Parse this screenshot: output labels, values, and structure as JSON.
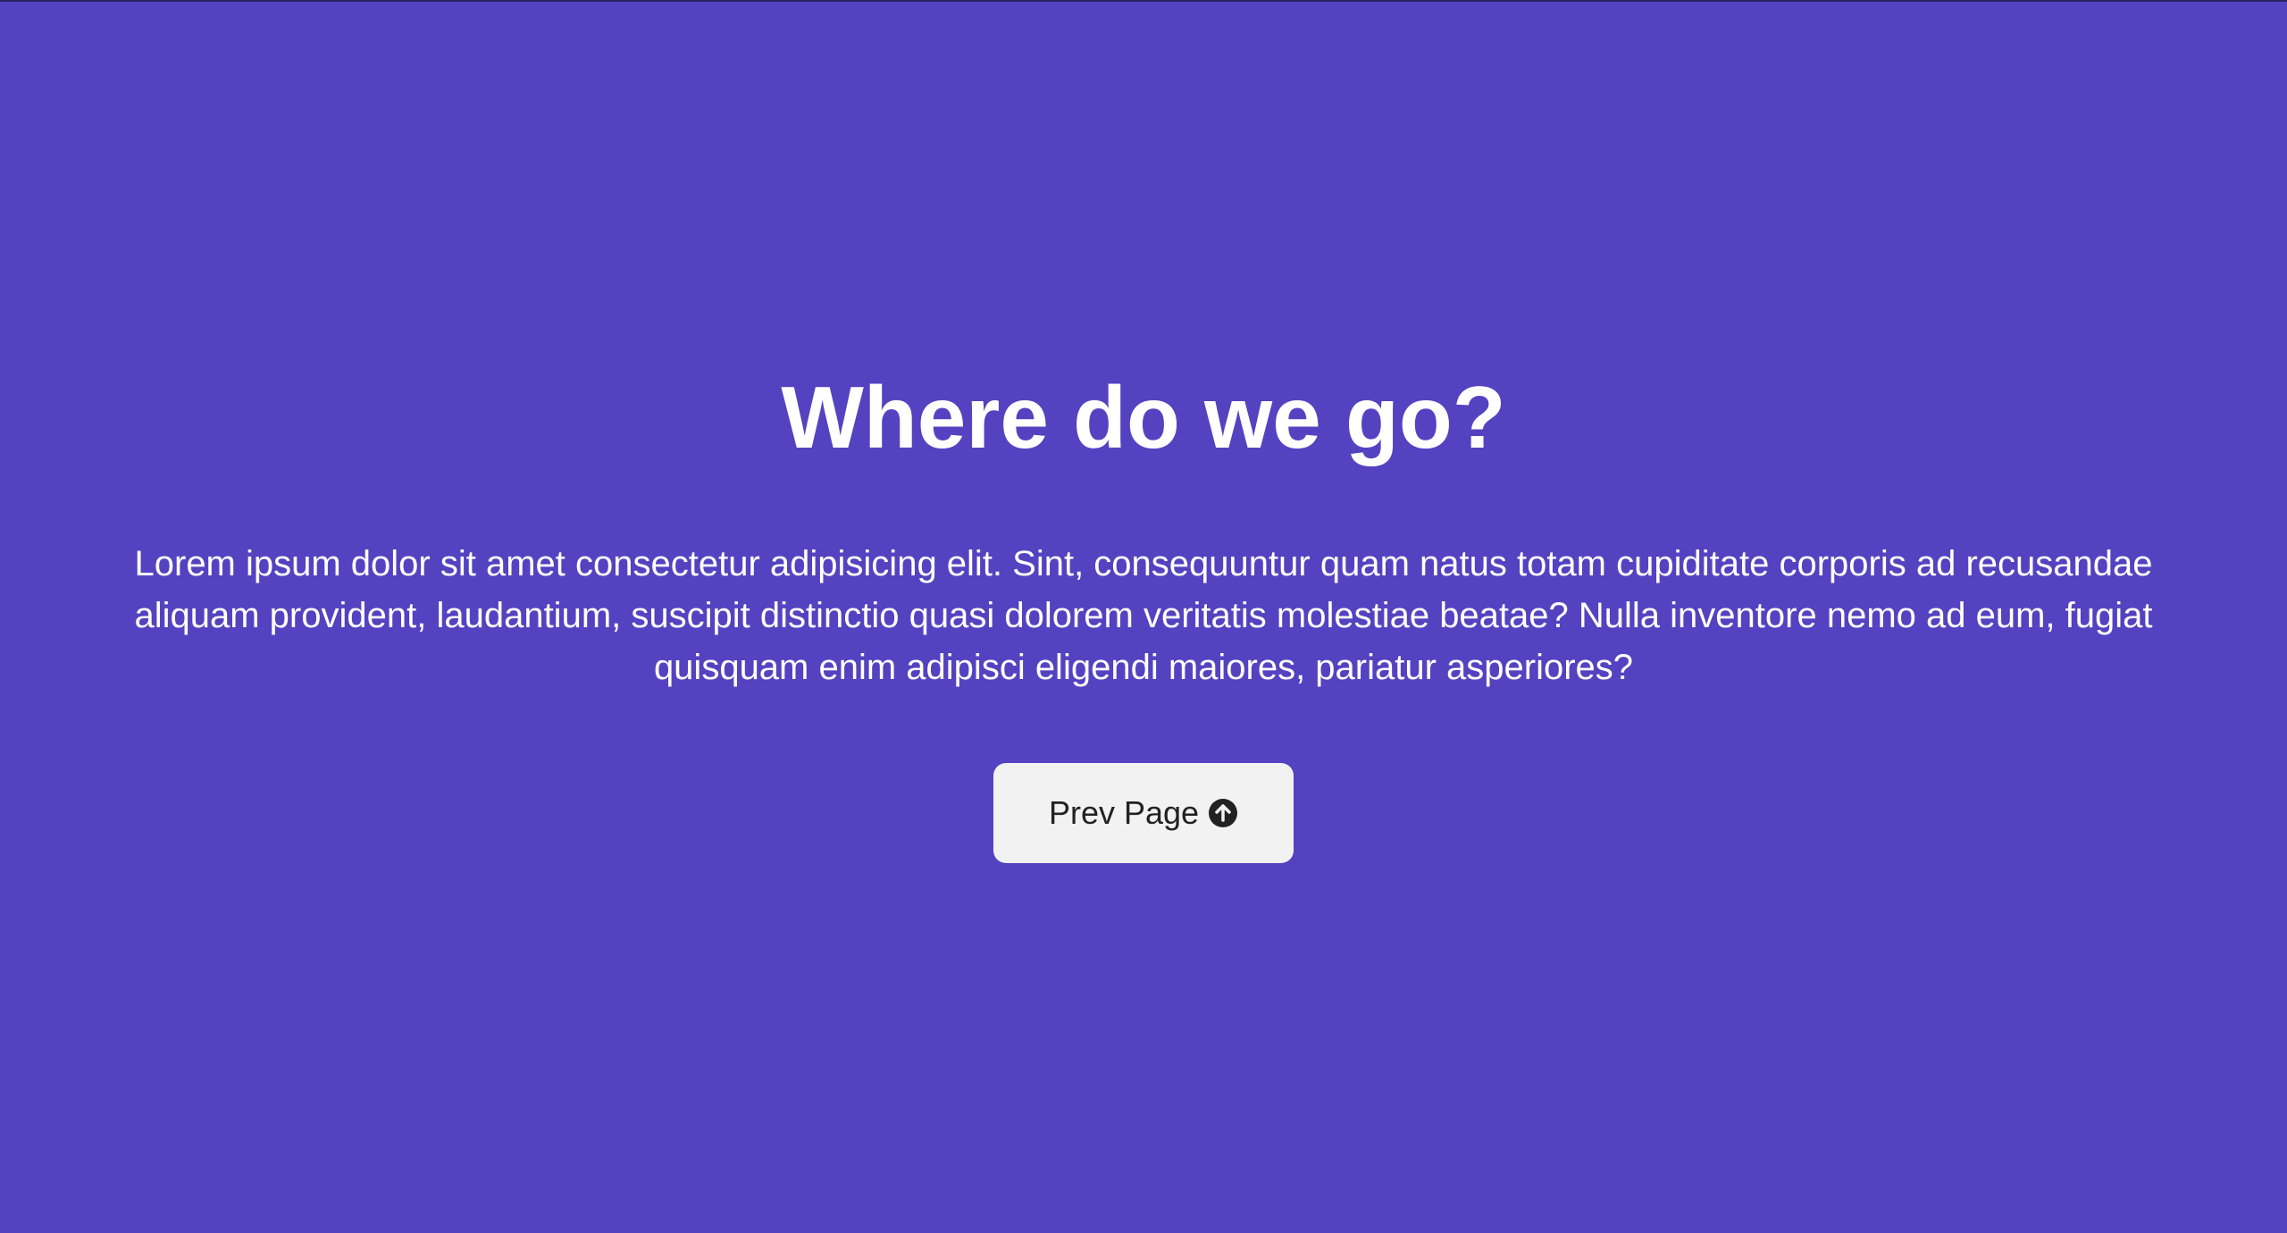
{
  "hero": {
    "title": "Where do we go?",
    "description": "Lorem ipsum dolor sit amet consectetur adipisicing elit. Sint, consequuntur quam natus totam cupiditate corporis ad recusandae aliquam provident, laudantium, suscipit distinctio quasi dolorem veritatis molestiae beatae? Nulla inventore nemo ad eum, fugiat quisquam enim adipisci eligendi maiores, pariatur asperiores?",
    "button": {
      "label": "Prev Page",
      "icon": "arrow-up-circle-icon"
    }
  },
  "colors": {
    "background": "#5542c1",
    "button_background": "#f2f2f2",
    "text": "#ffffff",
    "button_text": "#222222"
  }
}
